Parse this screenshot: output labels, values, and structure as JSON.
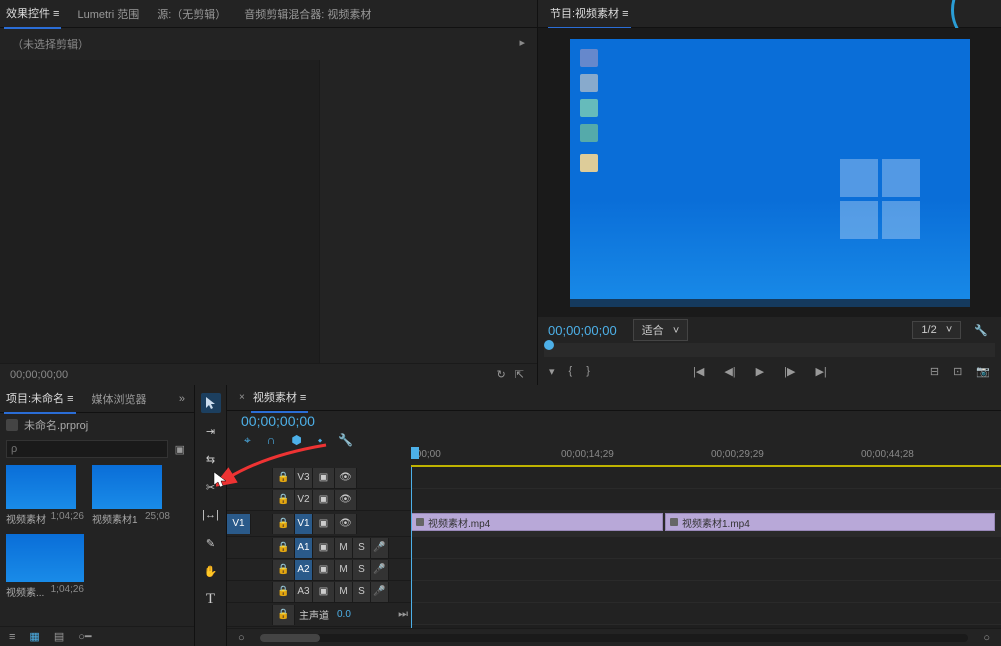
{
  "source_panel": {
    "tabs": [
      "效果控件 ≡",
      "Lumetri 范围",
      "源:（无剪辑）",
      "音频剪辑混合器: 视频素材"
    ],
    "subheader": "（未选择剪辑）",
    "timecode": "00;00;00;00"
  },
  "program_panel": {
    "tab": "节目:视频素材 ≡",
    "timecode": "00;00;00;00",
    "fit": "适合",
    "zoom": "1/2"
  },
  "project_panel": {
    "tabs": [
      "项目:未命名 ≡",
      "媒体浏览器"
    ],
    "project_file": "未命名.prproj",
    "search_placeholder": "ρ",
    "clips": [
      {
        "name": "视频素材",
        "duration": "1;04;26"
      },
      {
        "name": "视频素材1",
        "duration": "25;08"
      },
      {
        "name": "视频素...",
        "duration": "1;04;26"
      }
    ]
  },
  "tools": [
    "selection",
    "track-select",
    "ripple",
    "razor",
    "slip",
    "pen",
    "hand",
    "type"
  ],
  "timeline": {
    "tab": "视频素材",
    "timecode": "00;00;00;00",
    "ruler": [
      ";00;00",
      "00;00;14;29",
      "00;00;29;29",
      "00;00;44;28"
    ],
    "video_tracks": [
      {
        "id": "V3"
      },
      {
        "id": "V2"
      },
      {
        "id": "V1",
        "active": true
      }
    ],
    "audio_tracks": [
      {
        "id": "A1",
        "active": true
      },
      {
        "id": "A2",
        "active": true
      },
      {
        "id": "A3"
      }
    ],
    "master": "主声道",
    "master_val": "0.0",
    "clips": [
      {
        "name": "视频素材.mp4"
      },
      {
        "name": "视频素材1.mp4"
      }
    ],
    "v1_label": "V1",
    "m_label": "M",
    "s_label": "S"
  }
}
